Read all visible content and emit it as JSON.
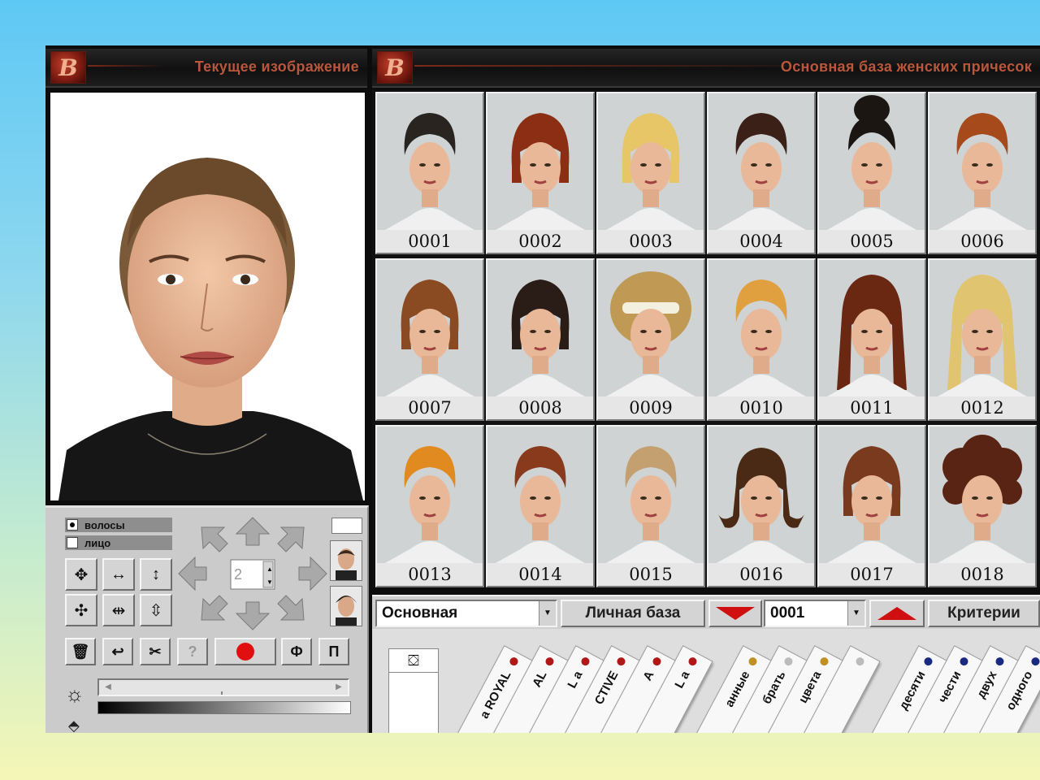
{
  "left_panel": {
    "title": "Текущее изображение",
    "logo_letter": "B",
    "controls": {
      "radio_hair": "волосы",
      "radio_face": "лицо",
      "spin_value": "2",
      "btn_f": "Ф",
      "btn_p": "П",
      "btn_help": "?"
    }
  },
  "right_panel": {
    "title": "Основная база женских причесок",
    "logo_letter": "B"
  },
  "hairstyles": [
    {
      "num": "0001",
      "hair": "#2a2420",
      "style": "short"
    },
    {
      "num": "0002",
      "hair": "#8c2e14",
      "style": "bob"
    },
    {
      "num": "0003",
      "hair": "#e6c666",
      "style": "bob"
    },
    {
      "num": "0004",
      "hair": "#3a2016",
      "style": "short"
    },
    {
      "num": "0005",
      "hair": "#1c1612",
      "style": "updo"
    },
    {
      "num": "0006",
      "hair": "#a64a1c",
      "style": "short"
    },
    {
      "num": "0007",
      "hair": "#8a4a22",
      "style": "bowl"
    },
    {
      "num": "0008",
      "hair": "#2a1c16",
      "style": "bob"
    },
    {
      "num": "0009",
      "hair": "#c09a54",
      "style": "band"
    },
    {
      "num": "0010",
      "hair": "#e0a040",
      "style": "short"
    },
    {
      "num": "0011",
      "hair": "#6a2812",
      "style": "long"
    },
    {
      "num": "0012",
      "hair": "#e0c470",
      "style": "long"
    },
    {
      "num": "0013",
      "hair": "#e08a20",
      "style": "short"
    },
    {
      "num": "0014",
      "hair": "#8a3a1c",
      "style": "short"
    },
    {
      "num": "0015",
      "hair": "#c4a070",
      "style": "short"
    },
    {
      "num": "0016",
      "hair": "#4a2a14",
      "style": "flip"
    },
    {
      "num": "0017",
      "hair": "#7a3a1e",
      "style": "bob"
    },
    {
      "num": "0018",
      "hair": "#5a2414",
      "style": "curly"
    }
  ],
  "bottombar": {
    "base_select": "Основная",
    "personal_base_label": "Личная база",
    "number_select": "0001",
    "criteria_label": "Критерии"
  },
  "tabs": [
    {
      "label": "a ROYAL",
      "dot": "#b01818"
    },
    {
      "label": "AL",
      "dot": "#b01818"
    },
    {
      "label": "L a",
      "dot": "#b01818"
    },
    {
      "label": "CTIVE",
      "dot": "#b01818"
    },
    {
      "label": "A",
      "dot": "#b01818"
    },
    {
      "label": "L a",
      "dot": "#b01818"
    },
    {
      "label": "анные",
      "dot": "#c09020"
    },
    {
      "label": "брать",
      "dot": "#bbbbbb"
    },
    {
      "label": "цвета",
      "dot": "#c09020"
    },
    {
      "label": "",
      "dot": "#bbbbbb"
    },
    {
      "label": "десяти",
      "dot": "#1a2a80"
    },
    {
      "label": "чести",
      "dot": "#1a2a80"
    },
    {
      "label": "двух",
      "dot": "#1a2a80"
    },
    {
      "label": "одного",
      "dot": "#1a2a80"
    }
  ]
}
